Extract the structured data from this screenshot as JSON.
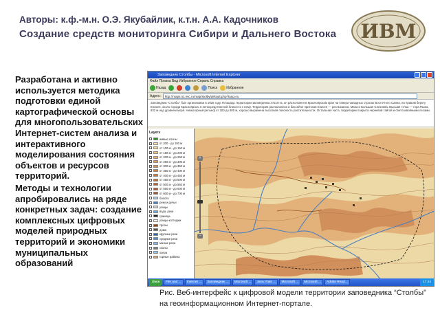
{
  "header": {
    "authors": "Авторы: к.ф.-м.н. О.Э. Якубайлик, к.т.н. А.А. Кадочников",
    "title": "Создание средств мониторинга Сибири и Дальнего Востока"
  },
  "logo": {
    "text": "ИВМ"
  },
  "body": {
    "paragraph1": "Разработана и активно используется методика подготовки единой картографической основы для многопользовательских Интернет-систем анализа и интерактивного моделирования состояния объектов и ресурсов территорий.",
    "paragraph2": "Методы и технологии апробировались на ряде конкретных задач: создание комплексных цифровых моделей природных территорий и экономики муниципальных образований"
  },
  "screenshot": {
    "window_title": "Заповедник Столбы - Microsoft Internet Explorer",
    "menu": "Файл   Правка   Вид   Избранное   Сервис   Справка",
    "toolbar": {
      "back": "Назад",
      "search": "Поиск",
      "favorites": "Избранное"
    },
    "address_label": "Адрес:",
    "address_value": "http://maps.ict.nsc.ru/map/stolby/default.php?lang=ru",
    "go_label": "Переход",
    "page_text": "Заповедник \"Столбы\" был организован в 1925 году. Площадь территории заповедника 47219 га, он расположен в Красноярском крае на северо-западных отрогах Восточного Саяна, на правом берегу Енисея, около города Красноярска, в непосредственной близости к нему. Территория расположена в бассейне притоков Енисея — рек Базаиха, Мана и Большая Слизнева. Высшая точка — гора Пыжа, 832 м над уровнем моря. Низкогорный рельеф от 200 до 800 м, хорошо выражена высотная поясность растительности. Остальная часть территории покрыта черневой тайгой и светлохвойными лесами.",
    "layers_title": "Layers",
    "layers": [
      {
        "label": "живые сосны",
        "color": "#2e8b2e"
      },
      {
        "label": "от 200 - до 100 м",
        "color": "#f3e6b4"
      },
      {
        "label": "от 100 м - до 150 м",
        "color": "#ecd79a"
      },
      {
        "label": "от 150 м - до 200 м",
        "color": "#e6c682"
      },
      {
        "label": "от 200 м - до 250 м",
        "color": "#e1b36a"
      },
      {
        "label": "от 250 м - до 300 м",
        "color": "#dca05a"
      },
      {
        "label": "от 300 м - до 350 м",
        "color": "#d8924e"
      },
      {
        "label": "от 350 м - до 400 м",
        "color": "#d08646"
      },
      {
        "label": "от 400 м - до 450 м",
        "color": "#c67a40"
      },
      {
        "label": "от 450 м - до 500 м",
        "color": "#bc6e3a"
      },
      {
        "label": "от 500 м - до 550 м",
        "color": "#b26436"
      },
      {
        "label": "от 550 м - до 600 м",
        "color": "#a85a32"
      },
      {
        "label": "от 600 м - до 700 м",
        "color": "#9e5230"
      },
      {
        "label": "болото",
        "color": "#a9c7d8"
      },
      {
        "label": "реки и ручьи",
        "color": "#4a7fc0"
      },
      {
        "label": "улицы",
        "color": "#cccccc"
      },
      {
        "label": "вода, реки",
        "color": "#6fa6dd"
      },
      {
        "label": "граница",
        "color": "#222222"
      },
      {
        "label": "улицы-коттеджи",
        "color": "#ffffff"
      },
      {
        "label": "тропы",
        "color": "#8b4513"
      },
      {
        "label": "дома",
        "color": "#555555"
      },
      {
        "label": "крупные реки",
        "color": "#2d63a8"
      },
      {
        "label": "средние реки",
        "color": "#5a8ccc"
      },
      {
        "label": "малые реки",
        "color": "#8fb6e0"
      },
      {
        "label": "скалы",
        "color": "#777777"
      },
      {
        "label": "озера",
        "color": "#9ac4ea"
      },
      {
        "label": "горные районы",
        "color": "#c9a27a"
      }
    ],
    "taskbar": {
      "start": "Пуск",
      "tasks": [
        "File and ...",
        "Internet ...",
        "Заповедник ...",
        "Microsoft ...",
        "Java: Rain ...",
        "Microsoft ...",
        "Microsoft ...",
        "Adobe Read..."
      ],
      "clock": "17:44"
    },
    "colors": {
      "map_low": "#ecd9a6",
      "map_mid": "#e3b27a",
      "map_high": "#d18f5c",
      "river": "#4a7fc0"
    }
  },
  "caption": "Рис. Веб-интерфейс к цифровой модели территории заповедника “Столбы” на геоинформационном Интернет-портале."
}
